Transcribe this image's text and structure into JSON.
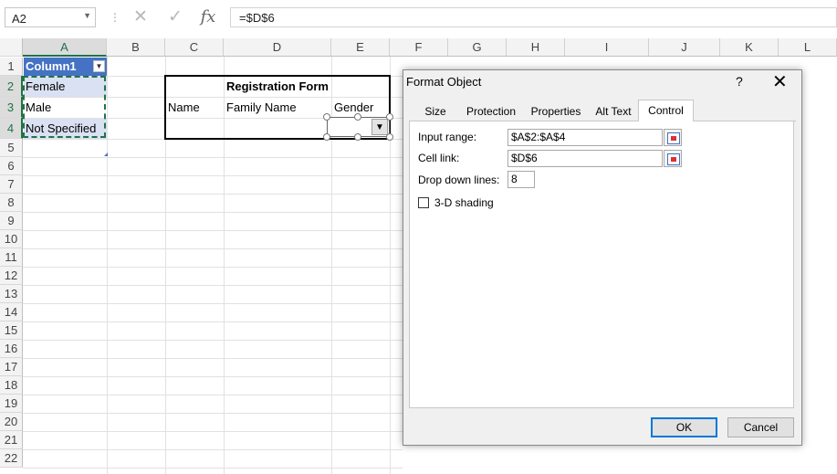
{
  "formula_bar": {
    "name_box": "A2",
    "cancel_icon": "✕",
    "enter_icon": "✓",
    "function_icon": "fx",
    "formula": "=$D$6"
  },
  "columns": [
    "A",
    "B",
    "C",
    "D",
    "E",
    "F",
    "G",
    "H",
    "I",
    "J",
    "K",
    "L"
  ],
  "rows": [
    "1",
    "2",
    "3",
    "4",
    "5",
    "6",
    "7",
    "8",
    "9",
    "10",
    "11",
    "12",
    "13",
    "14",
    "15",
    "16",
    "17",
    "18",
    "19",
    "20",
    "21",
    "22"
  ],
  "sheet": {
    "table_header": "Column1",
    "a2": "Female",
    "a3": "Male",
    "a4": "Not Specified",
    "form_title": "Registration Form",
    "c3": "Name",
    "d3": "Family Name",
    "e3": "Gender"
  },
  "dialog": {
    "title": "Format Object",
    "help": "?",
    "close": "✕",
    "tabs": [
      "Size",
      "Protection",
      "Properties",
      "Alt Text",
      "Control"
    ],
    "active_tab": "Control",
    "input_range_label": "Input range:",
    "input_range_value": "$A$2:$A$4",
    "cell_link_label": "Cell link:",
    "cell_link_value": "$D$6",
    "drop_down_lines_label": "Drop down lines:",
    "drop_down_lines_value": "8",
    "shading_label": "3-D shading",
    "shading_checked": false,
    "ok_label": "OK",
    "cancel_label": "Cancel"
  },
  "colors": {
    "table_header": "#4472c4",
    "table_band": "#d9e1f2",
    "selection_green": "#217346",
    "ok_focus": "#0078d7"
  }
}
